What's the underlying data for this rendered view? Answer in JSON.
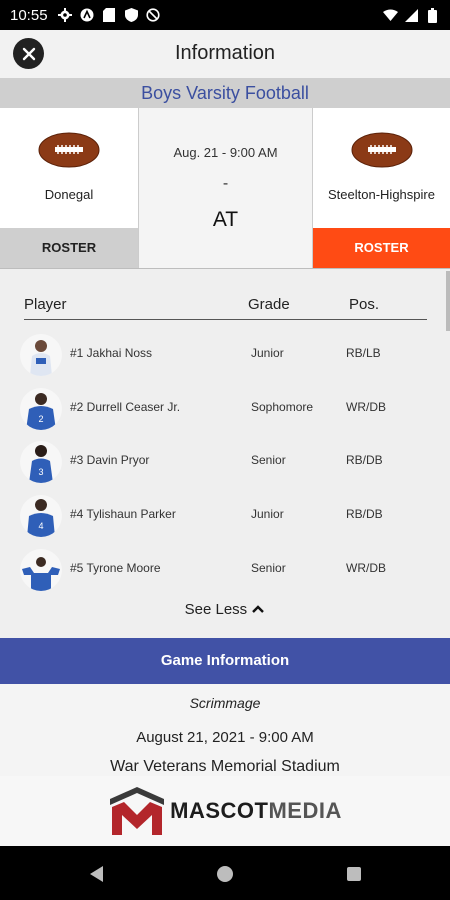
{
  "status_bar": {
    "time": "10:55",
    "icons": [
      "gear-icon",
      "a-circle-icon",
      "sd-card-icon",
      "shield-icon",
      "blocked-icon"
    ],
    "right_icons": [
      "wifi-icon",
      "signal-icon",
      "battery-icon"
    ]
  },
  "header": {
    "title": "Information"
  },
  "sport": "Boys Varsity Football",
  "matchup": {
    "home": {
      "name": "Donegal",
      "roster_label": "ROSTER"
    },
    "away": {
      "name": "Steelton-Highspire",
      "roster_label": "ROSTER"
    },
    "date": "Aug. 21 - 9:00 AM",
    "dash": "-",
    "at": "AT"
  },
  "roster": {
    "columns": {
      "player": "Player",
      "grade": "Grade",
      "pos": "Pos."
    },
    "players": [
      {
        "name": "#1 Jakhai Noss",
        "grade": "Junior",
        "pos": "RB/LB"
      },
      {
        "name": "#2 Durrell  Ceaser Jr.",
        "grade": "Sophomore",
        "pos": "WR/DB"
      },
      {
        "name": "#3 Davin  Pryor",
        "grade": "Senior",
        "pos": "RB/DB"
      },
      {
        "name": "#4 Tylishaun  Parker",
        "grade": "Junior",
        "pos": "RB/DB"
      },
      {
        "name": "#5 Tyrone  Moore",
        "grade": "Senior",
        "pos": "WR/DB"
      }
    ],
    "see_less": "See Less"
  },
  "game_info": {
    "title": "Game Information",
    "type": "Scrimmage",
    "date": "August 21, 2021 - 9:00 AM",
    "venue": "War Veterans Memorial Stadium"
  },
  "sponsor": {
    "name_part1": "MASCOT",
    "name_part2": "MEDIA"
  },
  "colors": {
    "accent_blue": "#4152a6",
    "away_orange": "#ff4b14",
    "sponsor_red": "#b3262b"
  }
}
